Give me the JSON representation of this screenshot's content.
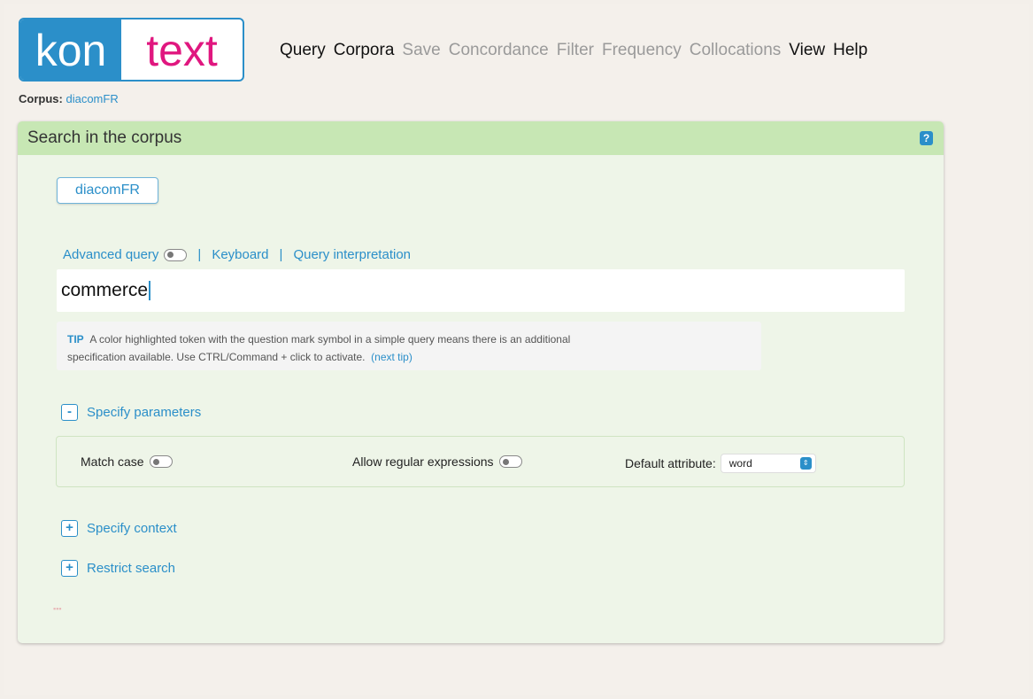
{
  "logo": {
    "part1": "kon",
    "part2": "text"
  },
  "menu": [
    {
      "label": "Query",
      "state": "active"
    },
    {
      "label": "Corpora",
      "state": "active"
    },
    {
      "label": "Save",
      "state": "disabled"
    },
    {
      "label": "Concordance",
      "state": "disabled"
    },
    {
      "label": "Filter",
      "state": "disabled"
    },
    {
      "label": "Frequency",
      "state": "disabled"
    },
    {
      "label": "Collocations",
      "state": "disabled"
    },
    {
      "label": "View",
      "state": "active"
    },
    {
      "label": "Help",
      "state": "active"
    }
  ],
  "corpus": {
    "label": "Corpus:",
    "name": "diacomFR"
  },
  "panel": {
    "title": "Search in the corpus",
    "help_icon": "?",
    "corpus_button": "diacomFR"
  },
  "query_links": {
    "advanced": "Advanced query",
    "keyboard": "Keyboard",
    "interpretation": "Query interpretation",
    "separator": "|"
  },
  "query": {
    "value": "commerce"
  },
  "tip": {
    "label": "TIP",
    "text_line1": "A color highlighted token with the question mark symbol in a simple query means there is an additional",
    "text_line2": "specification available. Use CTRL/Command + click to activate.",
    "link": "(next tip)"
  },
  "sections": {
    "parameters": {
      "symbol": "-",
      "label": "Specify parameters"
    },
    "context": {
      "symbol": "+",
      "label": "Specify context"
    },
    "restrict": {
      "symbol": "+",
      "label": "Restrict search"
    }
  },
  "params": {
    "match_case": "Match case",
    "regex": "Allow regular expressions",
    "default_attr_label": "Default attribute:",
    "default_attr_value": "word"
  },
  "colors": {
    "brand_blue": "#2b8fc9",
    "brand_pink": "#e0177f",
    "panel_header": "#c7e7b4",
    "panel_body": "#eef5e8"
  }
}
